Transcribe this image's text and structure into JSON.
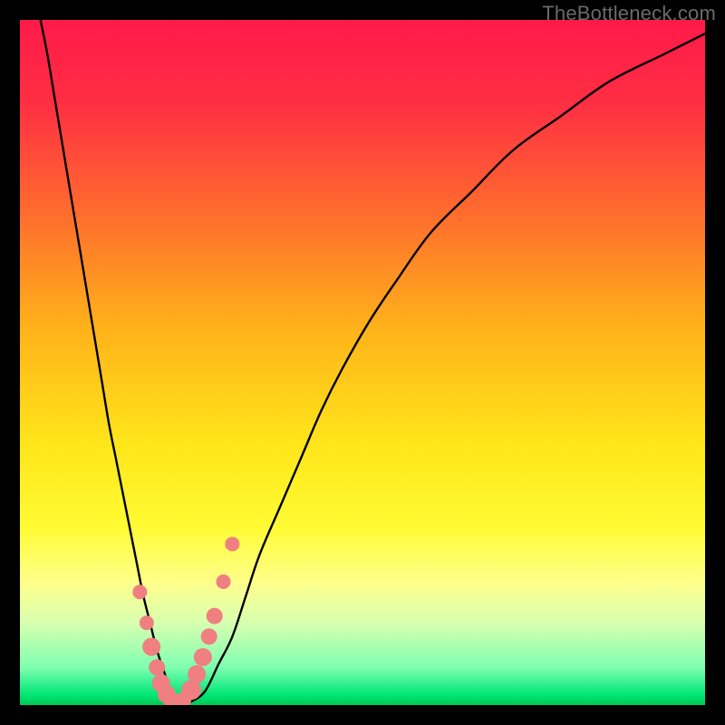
{
  "watermark": "TheBottleneck.com",
  "colors": {
    "frame": "#000000",
    "gradient_stops": [
      {
        "offset": 0.0,
        "color": "#ff1a4a"
      },
      {
        "offset": 0.12,
        "color": "#ff2e43"
      },
      {
        "offset": 0.28,
        "color": "#ff6b2e"
      },
      {
        "offset": 0.45,
        "color": "#ffb21a"
      },
      {
        "offset": 0.62,
        "color": "#ffe61a"
      },
      {
        "offset": 0.74,
        "color": "#fffb33"
      },
      {
        "offset": 0.82,
        "color": "#ffff8a"
      },
      {
        "offset": 0.88,
        "color": "#d8ffb0"
      },
      {
        "offset": 0.945,
        "color": "#7fffb0"
      },
      {
        "offset": 0.985,
        "color": "#00e676"
      },
      {
        "offset": 1.0,
        "color": "#00c853"
      }
    ],
    "curve": "#000000",
    "marker_fill": "#ef7f80",
    "marker_stroke": "#b55252"
  },
  "chart_data": {
    "type": "line",
    "title": "",
    "xlabel": "",
    "ylabel": "",
    "xlim": [
      0,
      100
    ],
    "ylim": [
      0,
      100
    ],
    "x": [
      3,
      4,
      5,
      6,
      7,
      8,
      9,
      10,
      11,
      12,
      13,
      14,
      15,
      16,
      17,
      18,
      19,
      20,
      21,
      22,
      23,
      24,
      25,
      27,
      29,
      31,
      33,
      35,
      38,
      41,
      44,
      47,
      51,
      55,
      60,
      66,
      72,
      79,
      86,
      94,
      100
    ],
    "y": [
      100,
      95,
      89,
      83,
      77,
      71,
      65,
      59,
      53,
      47,
      41,
      36,
      31,
      26,
      21,
      16,
      12,
      8,
      5,
      2,
      0.5,
      0,
      0.5,
      2,
      6,
      10,
      16,
      22,
      29,
      36,
      43,
      49,
      56,
      62,
      69,
      75,
      81,
      86,
      91,
      95,
      98
    ],
    "markers": {
      "x": [
        17.5,
        18.5,
        19.2,
        20.0,
        20.6,
        21.4,
        22.3,
        23.2,
        23.8,
        25.0,
        25.8,
        26.7,
        27.6,
        28.4,
        29.7,
        31.0
      ],
      "y": [
        16.5,
        12.0,
        8.5,
        5.5,
        3.2,
        1.6,
        0.5,
        0.35,
        0.6,
        2.2,
        4.5,
        7.0,
        10.0,
        13.0,
        18.0,
        23.5
      ],
      "sizes": [
        8,
        8,
        10,
        9,
        10,
        10,
        10,
        10,
        9,
        11,
        10,
        10,
        9,
        9,
        8,
        8
      ]
    }
  }
}
